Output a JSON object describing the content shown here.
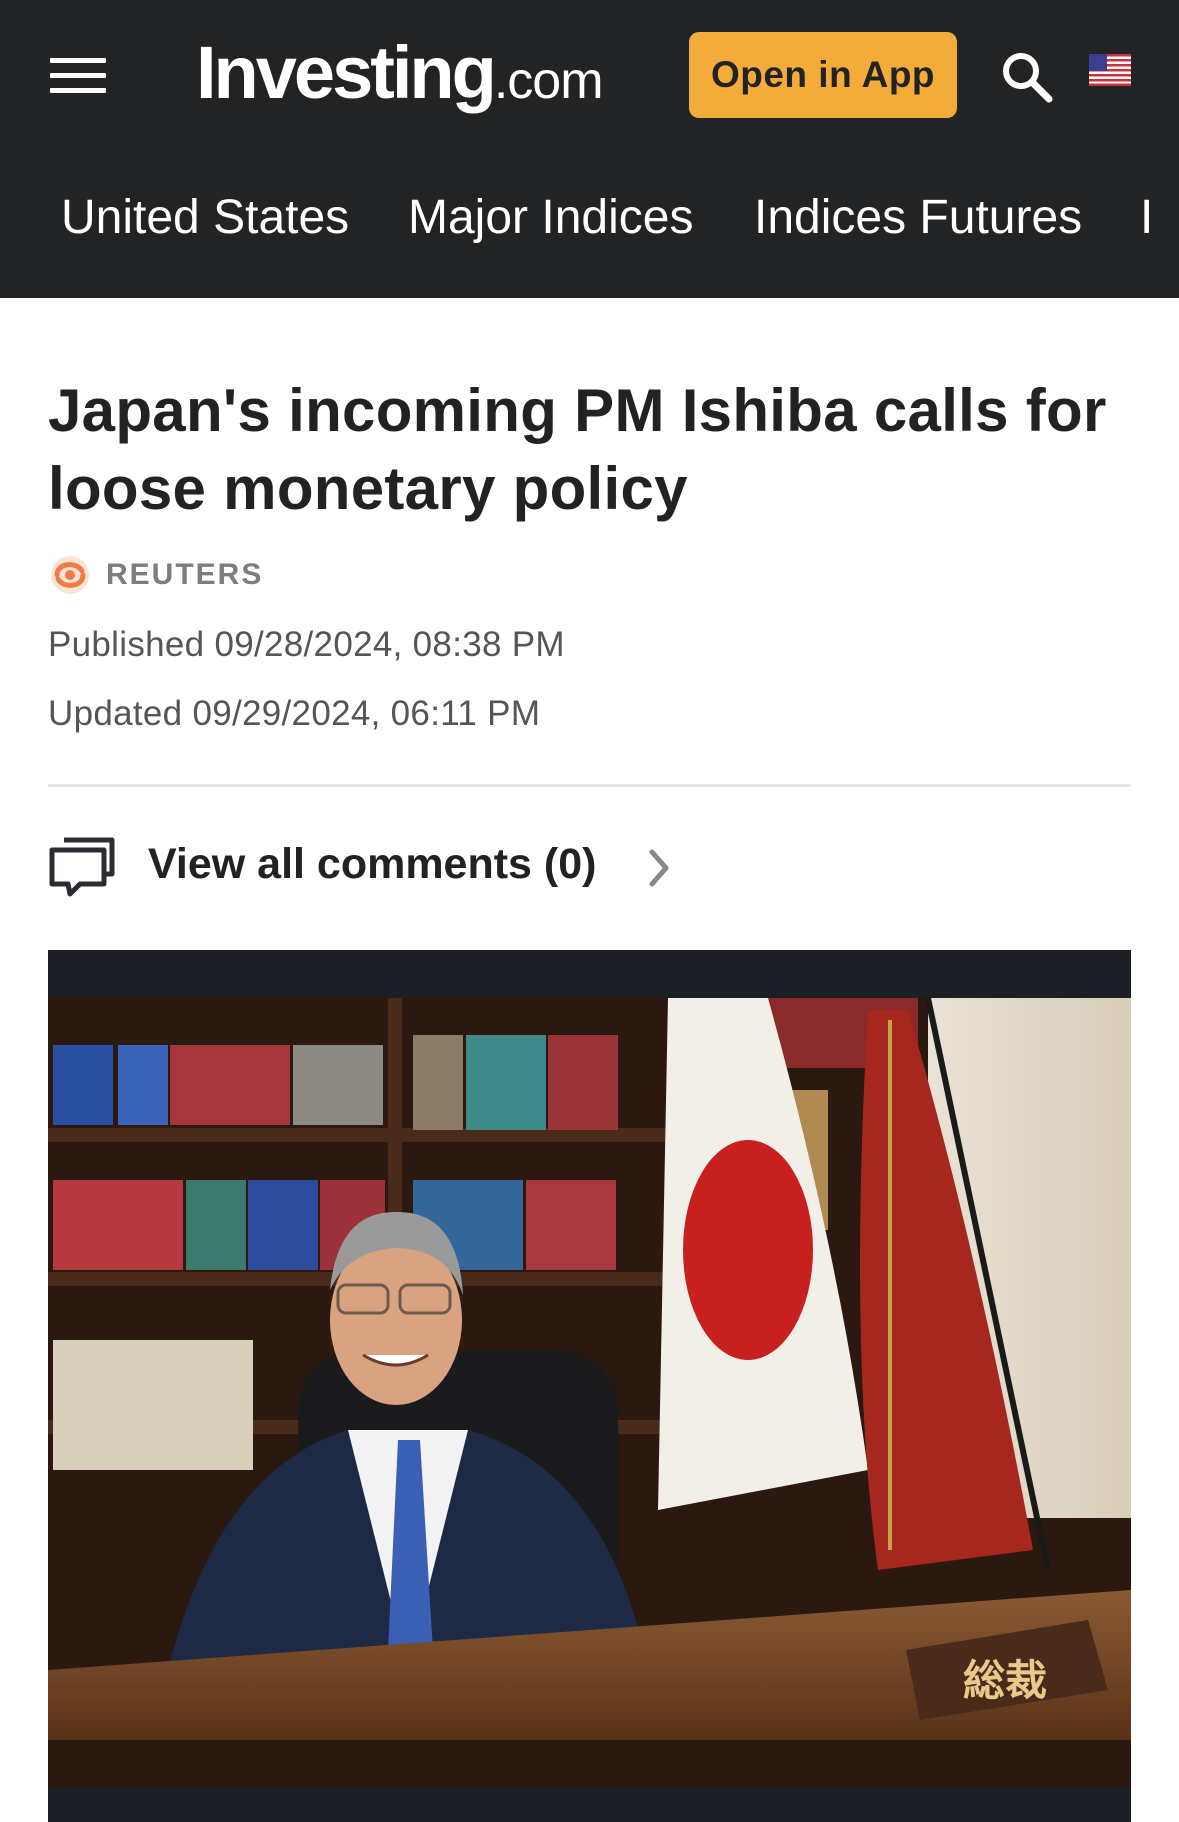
{
  "header": {
    "logo_brand": "Investing",
    "logo_tld": ".com",
    "open_app_label": "Open in App",
    "menu_icon": "hamburger-menu-icon",
    "search_icon": "search-icon",
    "flag_icon": "us-flag-icon"
  },
  "nav": {
    "items": [
      "United States",
      "Major Indices",
      "Indices Futures",
      "I"
    ]
  },
  "article": {
    "title": "Japan's incoming PM Ishiba calls for loose monetary policy",
    "source": "REUTERS",
    "published": "Published 09/28/2024, 08:38 PM",
    "updated": "Updated 09/29/2024, 06:11 PM",
    "comments_label": "View all comments (0)"
  },
  "photo": {
    "desk_plate_text": "総裁"
  },
  "colors": {
    "header_bg": "#222324",
    "accent": "#f3ac3a",
    "text": "#222222",
    "muted": "#555555"
  }
}
